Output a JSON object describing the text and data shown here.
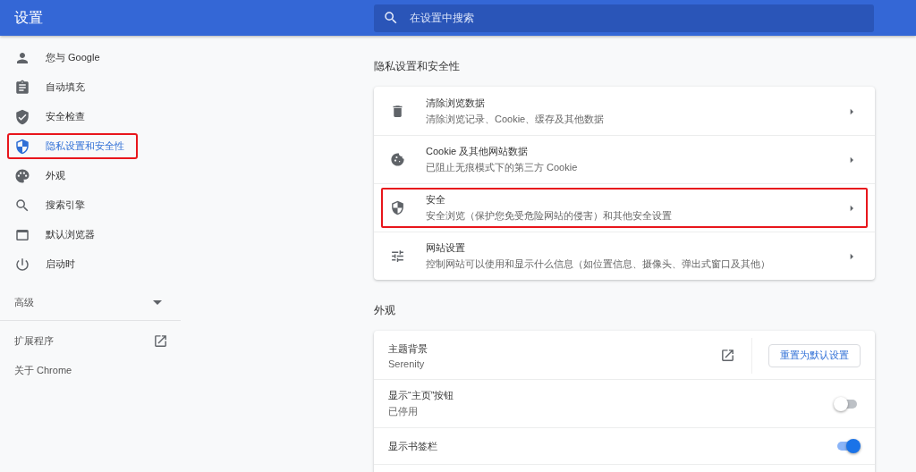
{
  "header": {
    "title": "设置",
    "search": {
      "placeholder": "在设置中搜索"
    }
  },
  "sidebar": {
    "items": [
      {
        "label": "您与 Google",
        "selected": false,
        "highlighted": false
      },
      {
        "label": "自动填充",
        "selected": false,
        "highlighted": false
      },
      {
        "label": "安全检查",
        "selected": false,
        "highlighted": false
      },
      {
        "label": "隐私设置和安全性",
        "selected": true,
        "highlighted": true
      },
      {
        "label": "外观",
        "selected": false,
        "highlighted": false
      },
      {
        "label": "搜索引擎",
        "selected": false,
        "highlighted": false
      },
      {
        "label": "默认浏览器",
        "selected": false,
        "highlighted": false
      },
      {
        "label": "启动时",
        "selected": false,
        "highlighted": false
      }
    ],
    "advanced": {
      "label": "高级",
      "expanded": false
    },
    "extensions": {
      "label": "扩展程序"
    },
    "about": {
      "label": "关于 Chrome"
    }
  },
  "privacy": {
    "title": "隐私设置和安全性",
    "rows": [
      {
        "title": "清除浏览数据",
        "subtitle": "清除浏览记录、Cookie、缓存及其他数据",
        "highlighted": false
      },
      {
        "title": "Cookie 及其他网站数据",
        "subtitle": "已阻止无痕模式下的第三方 Cookie",
        "highlighted": false
      },
      {
        "title": "安全",
        "subtitle": "安全浏览（保护您免受危险网站的侵害）和其他安全设置",
        "highlighted": true
      },
      {
        "title": "网站设置",
        "subtitle": "控制网站可以使用和显示什么信息（如位置信息、摄像头、弹出式窗口及其他）",
        "highlighted": false
      }
    ]
  },
  "appearance": {
    "title": "外观",
    "rows": [
      {
        "kind": "theme",
        "title": "主题背景",
        "subtitle": "Serenity",
        "button": "重置为默认设置"
      },
      {
        "kind": "toggle",
        "title": "显示“主页”按钮",
        "subtitle": "已停用",
        "on": false
      },
      {
        "kind": "toggle",
        "title": "显示书签栏",
        "on": true
      }
    ]
  }
}
